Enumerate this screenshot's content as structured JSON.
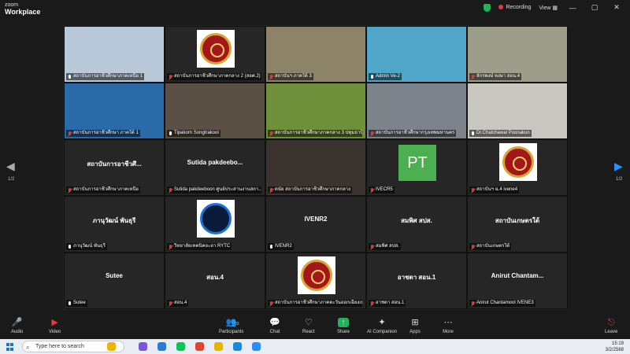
{
  "app": {
    "logo_top": "zoom",
    "logo_bottom": "Workplace"
  },
  "titlebar": {
    "recording": "Recording",
    "view": "View"
  },
  "pager": {
    "left": "1/2",
    "right": "1/2"
  },
  "tiles": [
    {
      "caption": "สถาบันการอาชีวศึกษาภาคเหนือ 1",
      "muted": false,
      "kind": "video",
      "bg": "#b9c9d9"
    },
    {
      "caption": "สถาบันการอาชีวศึกษาภาคกลาง 2 (สอศ.2)",
      "muted": true,
      "kind": "emblem",
      "bg": "#2b2b2b"
    },
    {
      "caption": "สถาบันฯ ภาคใต้ 3",
      "muted": true,
      "kind": "video",
      "bg": "#8d8468"
    },
    {
      "caption": "Admin Ve-2",
      "muted": false,
      "kind": "video",
      "bg": "#4fa6c9"
    },
    {
      "caption": "จักรพงษ์ หงษา สอน.4",
      "muted": true,
      "kind": "video",
      "bg": "#9c9e8a"
    },
    {
      "caption": "สถาบันการอาชีวศึกษา ภาคใต้ 1",
      "muted": true,
      "kind": "video",
      "bg": "#2a6aa8"
    },
    {
      "caption": "Tipakorn Songtrakool",
      "muted": false,
      "kind": "video",
      "bg": "#5a5046"
    },
    {
      "caption": "สถาบันการอาชีวศึกษาภาคกลาง 3 ปทุมธานี",
      "muted": true,
      "kind": "video",
      "bg": "#6f8f3a"
    },
    {
      "caption": "สถาบันการอาชีวศึกษากรุงเทพมหานคร",
      "muted": true,
      "kind": "video",
      "bg": "#7c838a"
    },
    {
      "caption": "Dr.Chatchawal Poonakun",
      "muted": false,
      "kind": "video",
      "bg": "#c8c7c0"
    },
    {
      "caption": "สถาบันการอาชีวศึกษาภาคเหนือ",
      "muted": true,
      "kind": "name",
      "name": "สถาบันการอาชีวศึ..."
    },
    {
      "caption": "Sutida pakdeeboon ศูนย์ประสานงานสถา...",
      "muted": true,
      "kind": "name",
      "name": "Sutida pakdeebo..."
    },
    {
      "caption": "ดนัย สถาบันการอาชีวศึกษาภาคกลาง",
      "muted": true,
      "kind": "video",
      "bg": "#3b3330"
    },
    {
      "caption": "IVECR5",
      "muted": true,
      "kind": "pt",
      "initials": "PT"
    },
    {
      "caption": "สถาบันฯ ฉ.4 ivene4",
      "muted": true,
      "kind": "emblem"
    },
    {
      "caption": "ภานุวัฒน์ พันธุรี",
      "muted": false,
      "kind": "name",
      "name": "ภานุวัฒน์ พันธุรี"
    },
    {
      "caption": "วิทยาลัยเทคนิคยะลา RYTC",
      "muted": true,
      "kind": "studio"
    },
    {
      "caption": "IVENR2",
      "muted": false,
      "kind": "name",
      "name": "IVENR2"
    },
    {
      "caption": "สมพิศ สปส.",
      "muted": true,
      "kind": "name",
      "name": "สมพิศ สปส."
    },
    {
      "caption": "สถาบันเกษตรใต้",
      "muted": true,
      "kind": "name",
      "name": "สถาบันเกษตรใต้"
    },
    {
      "caption": "Sutee",
      "muted": false,
      "kind": "name",
      "name": "Sutee"
    },
    {
      "caption": "สอน.4",
      "muted": true,
      "kind": "name",
      "name": "สอน.4"
    },
    {
      "caption": "สถาบันการอาชีวศึกษาภาคตะวันออกเฉียงเหนือ",
      "muted": true,
      "kind": "emblem"
    },
    {
      "caption": "อาชดา สอน.1",
      "muted": true,
      "kind": "name",
      "name": "อาชดา สอน.1"
    },
    {
      "caption": "Anirut Chantamool IVENE3",
      "muted": true,
      "kind": "name",
      "name": "Anirut  Chantam..."
    }
  ],
  "toolbar": {
    "audio": "Audio",
    "video": "Video",
    "participants": "Participants",
    "participants_count": "33",
    "chat": "Chat",
    "react": "React",
    "share": "Share",
    "ai": "AI Companion",
    "apps": "Apps",
    "more": "More",
    "leave": "Leave"
  },
  "taskbar": {
    "search_placeholder": "Type here to search",
    "time": "15:19",
    "date": "3/2/2568"
  }
}
